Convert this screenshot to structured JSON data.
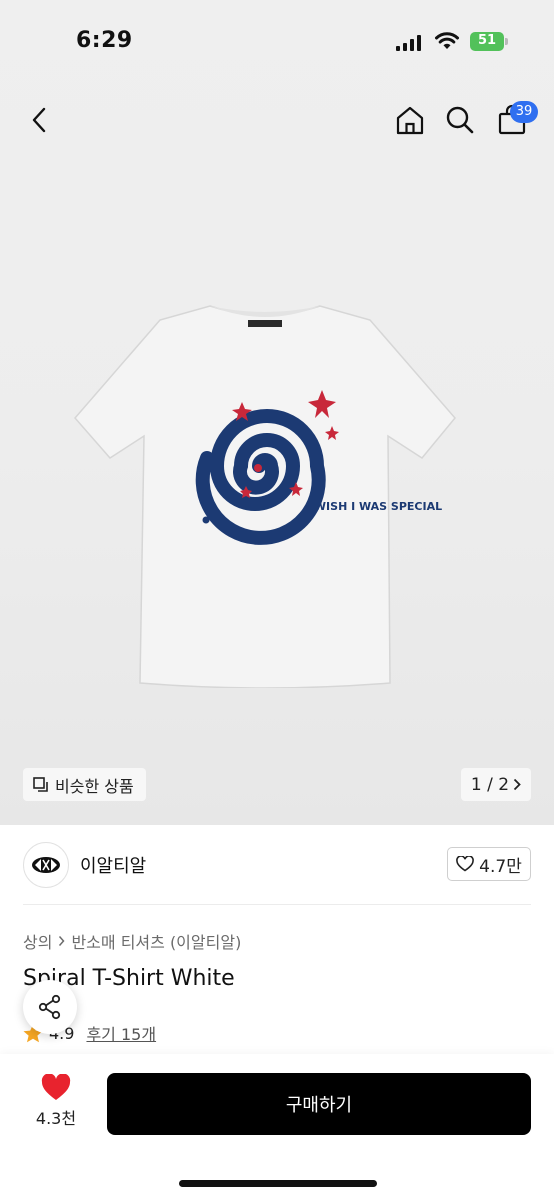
{
  "status_bar": {
    "time": "6:29",
    "battery": "51"
  },
  "header": {
    "cart_count": "39",
    "icons": [
      "back-icon",
      "home-icon",
      "search-icon",
      "bag-icon"
    ]
  },
  "product_image": {
    "print_text": "I WISH I WAS SPECIAL",
    "similar_label": "비슷한 상품",
    "page_indicator": "1 / 2"
  },
  "brand": {
    "name": "이알티알",
    "likes": "4.7만"
  },
  "breadcrumb": {
    "category": "상의",
    "subcategory": "반소매 티셔츠 (이알티알)"
  },
  "product": {
    "title": "Spiral T-Shirt White",
    "rating": "4.9",
    "reviews": "후기 15개"
  },
  "bottom": {
    "wish_count": "4.3천",
    "buy_label": "구매하기"
  },
  "colors": {
    "accent": "#2f6ff0",
    "heart": "#e8232e",
    "star": "#f5a623",
    "buy": "#000000"
  }
}
